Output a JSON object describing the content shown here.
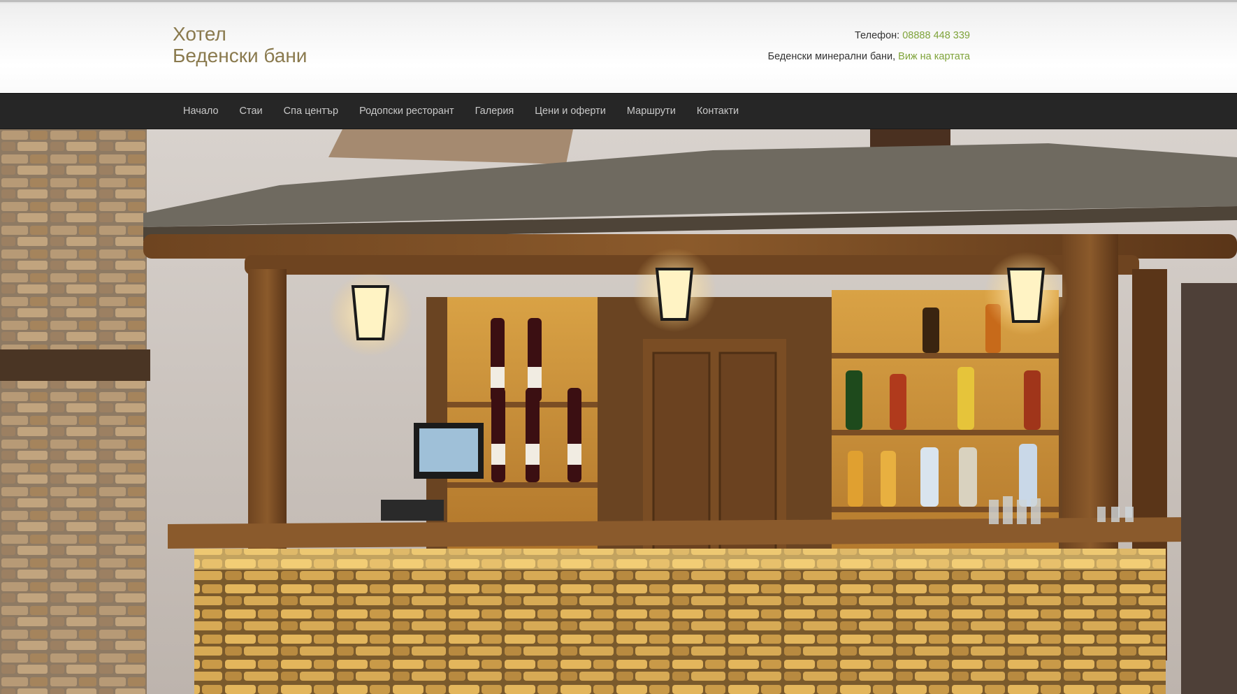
{
  "header": {
    "brand_line1": "Хотел",
    "brand_line2": "Беденски бани",
    "phone_label": "Телефон:",
    "phone_number": "08888 448 339",
    "location_text": "Беденски минерални бани,",
    "map_link": "Виж на картата"
  },
  "nav": {
    "items": [
      {
        "label": "Начало"
      },
      {
        "label": "Стаи"
      },
      {
        "label": "Спа център"
      },
      {
        "label": "Родопски ресторант"
      },
      {
        "label": "Галерия"
      },
      {
        "label": "Цени и оферти"
      },
      {
        "label": "Маршрути"
      },
      {
        "label": "Контакти"
      }
    ]
  },
  "hero": {
    "image_alt": "hero-photo"
  },
  "colors": {
    "brand": "#8a7a4e",
    "link": "#7fa33a",
    "nav_bg": "#262626",
    "nav_text": "#c9c9c9"
  }
}
